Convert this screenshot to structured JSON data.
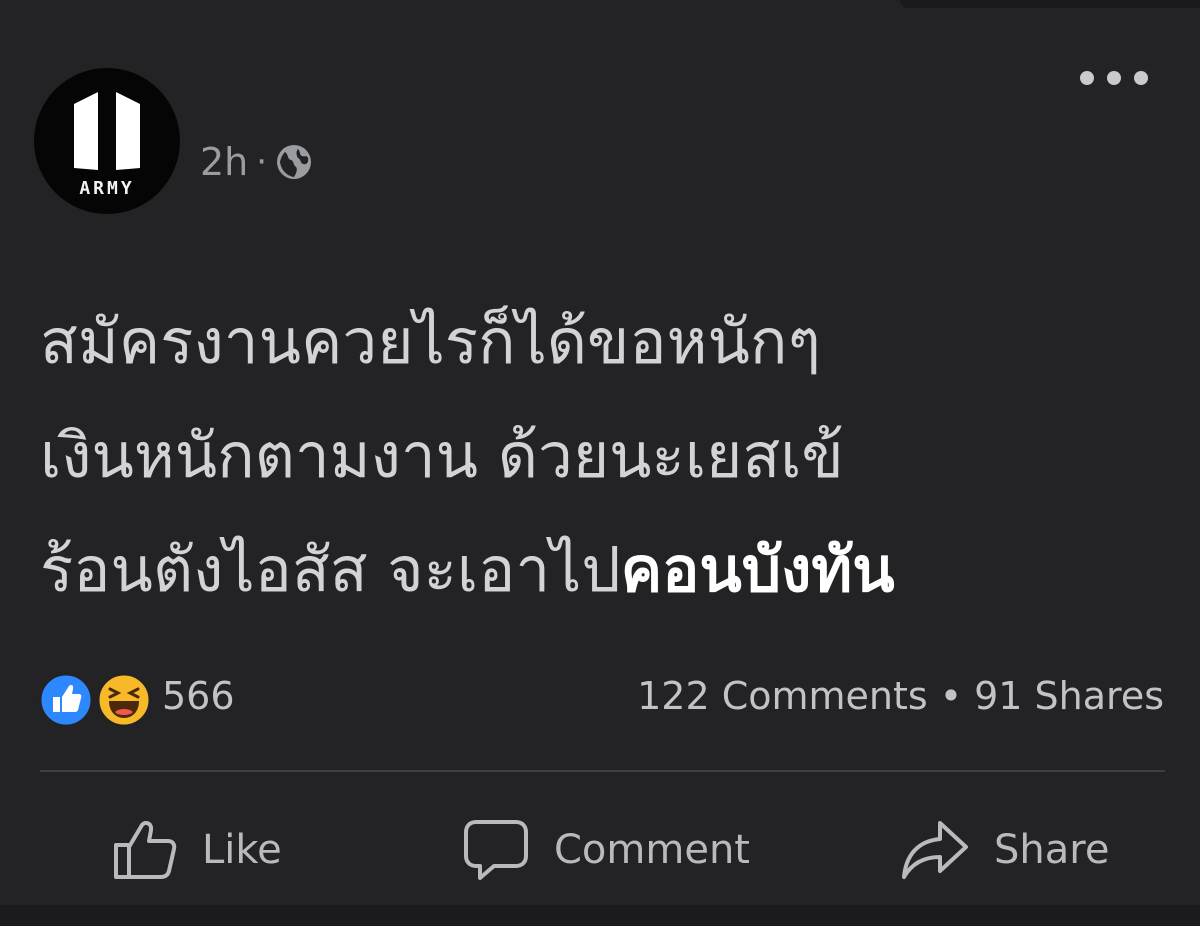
{
  "post": {
    "avatar_text": "ARMY",
    "time": "2h",
    "separator": "·",
    "privacy_icon": "globe-icon",
    "more_icon": "more-icon",
    "text_line1": "สมัครงานควยไรก็ได้ขอหนักๆ",
    "text_line2": "เงินหนักตามงาน ด้วยนะเยสเข้",
    "text_line3": "ร้อนตังไอสัส จะเอาไป",
    "text_highlight": "คอนบังทัน"
  },
  "reactions": {
    "icons": [
      "like-reaction-icon",
      "haha-reaction-icon"
    ],
    "count": "566"
  },
  "stats": {
    "comments": "122 Comments",
    "separator": "•",
    "shares": "91 Shares"
  },
  "actions": {
    "like": "Like",
    "comment": "Comment",
    "share": "Share"
  },
  "colors": {
    "background": "#232326",
    "text": "#d2d3d6",
    "like_blue": "#2d88ff",
    "haha_yellow": "#f7b928"
  }
}
